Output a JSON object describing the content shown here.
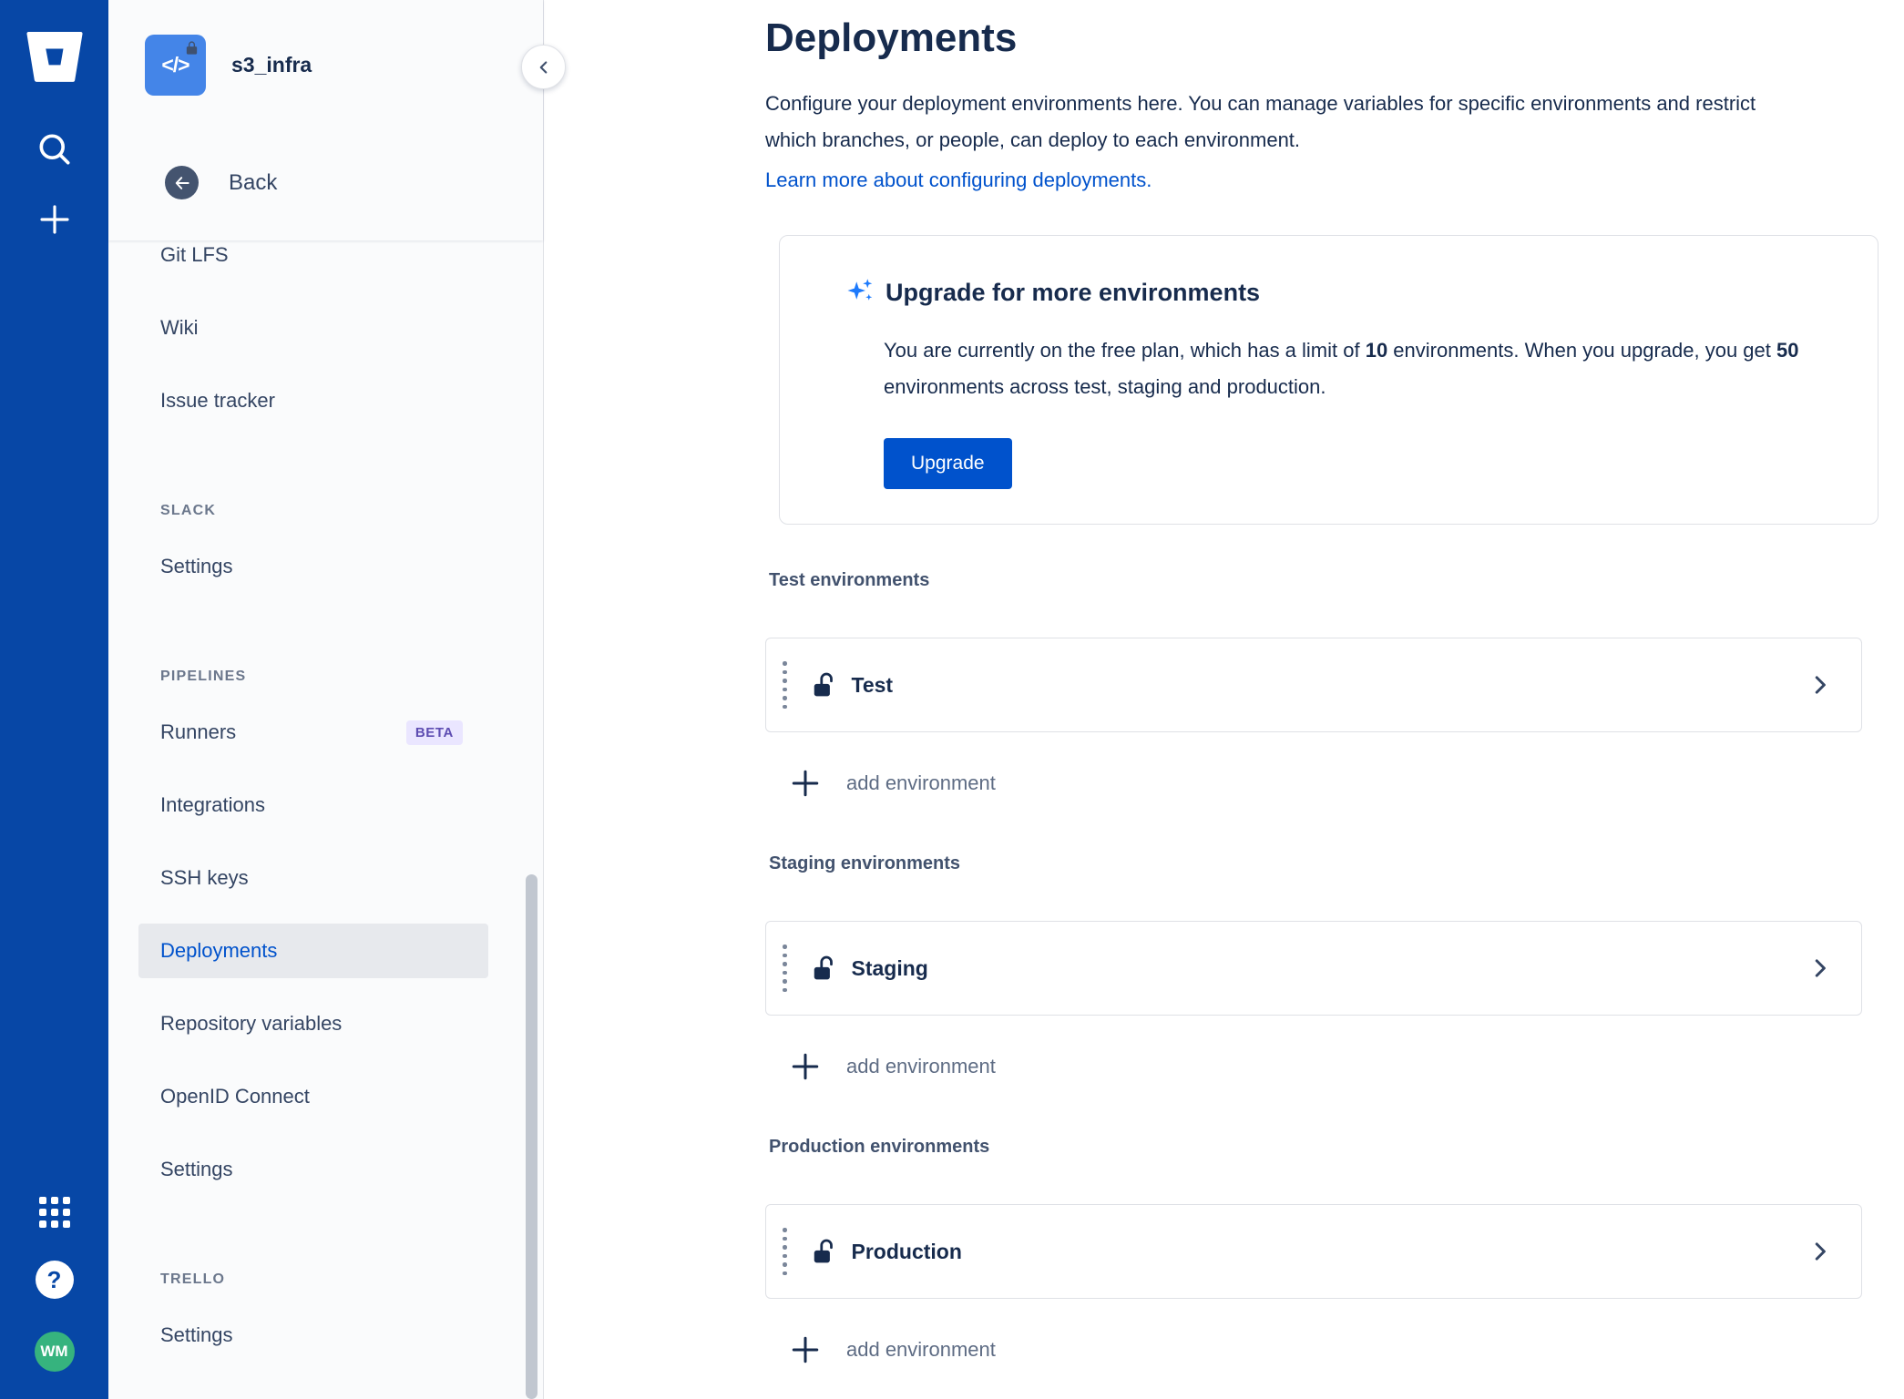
{
  "global_nav": {
    "avatar_initials": "WM"
  },
  "sidebar": {
    "repo_name": "s3_infra",
    "back_label": "Back",
    "sections": [
      {
        "items": [
          {
            "label": "Git LFS"
          },
          {
            "label": "Wiki"
          },
          {
            "label": "Issue tracker"
          }
        ]
      },
      {
        "header": "SLACK",
        "items": [
          {
            "label": "Settings"
          }
        ]
      },
      {
        "header": "PIPELINES",
        "items": [
          {
            "label": "Runners",
            "badge": "BETA"
          },
          {
            "label": "Integrations"
          },
          {
            "label": "SSH keys"
          },
          {
            "label": "Deployments",
            "selected": true
          },
          {
            "label": "Repository variables"
          },
          {
            "label": "OpenID Connect"
          },
          {
            "label": "Settings"
          }
        ]
      },
      {
        "header": "TRELLO",
        "items": [
          {
            "label": "Settings"
          }
        ]
      }
    ]
  },
  "main": {
    "title": "Deployments",
    "description": "Configure your deployment environments here. You can manage variables for specific environments and restrict which branches, or people, can deploy to each environment.",
    "learn_more": "Learn more about configuring deployments.",
    "upgrade": {
      "title": "Upgrade for more environments",
      "body_1": "You are currently on the free plan, which has a limit of ",
      "limit": "10",
      "body_2": " environments. When you upgrade, you get ",
      "upgraded": "50",
      "body_3": " environments across test, staging and production.",
      "button": "Upgrade"
    },
    "groups": [
      {
        "label": "Test environments",
        "env": "Test",
        "add_label": "add environment"
      },
      {
        "label": "Staging environments",
        "env": "Staging",
        "add_label": "add environment"
      },
      {
        "label": "Production environments",
        "env": "Production",
        "add_label": "add environment"
      }
    ]
  },
  "colors": {
    "brand_blue": "#0747A6",
    "link_blue": "#0052CC",
    "beta_purple_bg": "#EAE6FF",
    "beta_purple_text": "#5E4DB2",
    "avatar_green": "#36B37E",
    "card_border": "#DFE1E6"
  }
}
